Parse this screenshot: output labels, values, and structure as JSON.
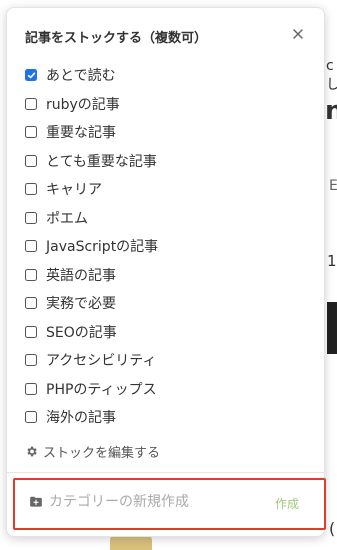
{
  "background": {
    "partial_texts": [
      "cし",
      "n",
      "E",
      "1",
      "("
    ]
  },
  "popup": {
    "title": "記事をストックする（複数可）",
    "close_icon": "close-icon",
    "items": [
      {
        "label": "あとで読む",
        "checked": true
      },
      {
        "label": "rubyの記事",
        "checked": false
      },
      {
        "label": "重要な記事",
        "checked": false
      },
      {
        "label": "とても重要な記事",
        "checked": false
      },
      {
        "label": "キャリア",
        "checked": false
      },
      {
        "label": "ポエム",
        "checked": false
      },
      {
        "label": "JavaScriptの記事",
        "checked": false
      },
      {
        "label": "英語の記事",
        "checked": false
      },
      {
        "label": "実務で必要",
        "checked": false
      },
      {
        "label": "SEOの記事",
        "checked": false
      },
      {
        "label": "アクセシビリティ",
        "checked": false
      },
      {
        "label": "PHPのティップス",
        "checked": false
      },
      {
        "label": "海外の記事",
        "checked": false
      }
    ],
    "edit_stock_label": "ストックを編集する",
    "edit_stock_icon": "gear-icon",
    "new_category": {
      "placeholder": "カテゴリーの新規作成",
      "value": "",
      "icon": "folder-plus-icon",
      "create_label": "作成",
      "highlight_color": "#e33b2b"
    },
    "accent_color": "#1f73e8"
  }
}
